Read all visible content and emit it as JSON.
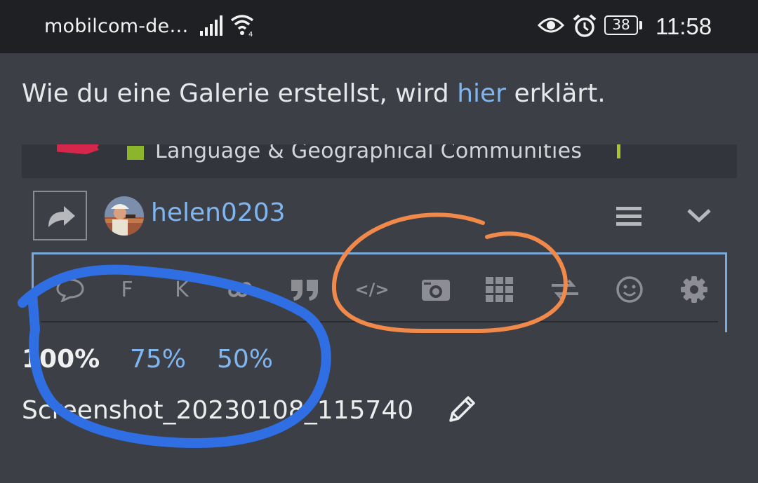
{
  "status_bar": {
    "carrier": "mobilcom-de…",
    "battery": "38",
    "time": "11:58",
    "icons": [
      "signal-icon",
      "wifi-icon",
      "eye-icon",
      "alarm-icon",
      "battery-icon"
    ]
  },
  "intro": {
    "before": "Wie du eine Galerie erstellst, wird ",
    "link": "hier",
    "after": " erklärt."
  },
  "embed": {
    "category": "Language & Geographical Communities"
  },
  "composer": {
    "username": "helen0203",
    "toolbar": [
      {
        "name": "speech-bubble-icon",
        "label": ""
      },
      {
        "name": "bold-button",
        "label": "F"
      },
      {
        "name": "italic-button",
        "label": "K"
      },
      {
        "name": "link-icon",
        "label": ""
      },
      {
        "name": "quote-icon",
        "label": ""
      },
      {
        "name": "code-icon",
        "label": "</>"
      },
      {
        "name": "image-upload-icon",
        "label": ""
      },
      {
        "name": "grid-icon",
        "label": ""
      },
      {
        "name": "swap-icon",
        "label": ""
      },
      {
        "name": "emoji-icon",
        "label": ""
      },
      {
        "name": "settings-gear-icon",
        "label": ""
      }
    ]
  },
  "image_zoom": {
    "options": [
      "100%",
      "75%",
      "50%"
    ],
    "selected": "100%"
  },
  "file": {
    "name": "Screenshot_20230108_115740"
  },
  "colors": {
    "background": "#3d3f47",
    "status_bar": "#1f2023",
    "link": "#7fb6f0",
    "blue_marker": "#2f6fe3",
    "orange_marker": "#f0894a"
  }
}
